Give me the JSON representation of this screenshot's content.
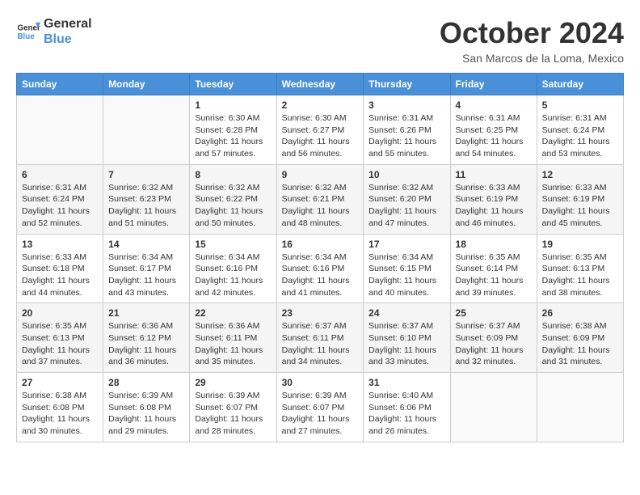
{
  "logo": {
    "line1": "General",
    "line2": "Blue"
  },
  "title": "October 2024",
  "location": "San Marcos de la Loma, Mexico",
  "days_header": [
    "Sunday",
    "Monday",
    "Tuesday",
    "Wednesday",
    "Thursday",
    "Friday",
    "Saturday"
  ],
  "weeks": [
    [
      {
        "day": "",
        "info": ""
      },
      {
        "day": "",
        "info": ""
      },
      {
        "day": "1",
        "info": "Sunrise: 6:30 AM\nSunset: 6:28 PM\nDaylight: 11 hours and 57 minutes."
      },
      {
        "day": "2",
        "info": "Sunrise: 6:30 AM\nSunset: 6:27 PM\nDaylight: 11 hours and 56 minutes."
      },
      {
        "day": "3",
        "info": "Sunrise: 6:31 AM\nSunset: 6:26 PM\nDaylight: 11 hours and 55 minutes."
      },
      {
        "day": "4",
        "info": "Sunrise: 6:31 AM\nSunset: 6:25 PM\nDaylight: 11 hours and 54 minutes."
      },
      {
        "day": "5",
        "info": "Sunrise: 6:31 AM\nSunset: 6:24 PM\nDaylight: 11 hours and 53 minutes."
      }
    ],
    [
      {
        "day": "6",
        "info": "Sunrise: 6:31 AM\nSunset: 6:24 PM\nDaylight: 11 hours and 52 minutes."
      },
      {
        "day": "7",
        "info": "Sunrise: 6:32 AM\nSunset: 6:23 PM\nDaylight: 11 hours and 51 minutes."
      },
      {
        "day": "8",
        "info": "Sunrise: 6:32 AM\nSunset: 6:22 PM\nDaylight: 11 hours and 50 minutes."
      },
      {
        "day": "9",
        "info": "Sunrise: 6:32 AM\nSunset: 6:21 PM\nDaylight: 11 hours and 48 minutes."
      },
      {
        "day": "10",
        "info": "Sunrise: 6:32 AM\nSunset: 6:20 PM\nDaylight: 11 hours and 47 minutes."
      },
      {
        "day": "11",
        "info": "Sunrise: 6:33 AM\nSunset: 6:19 PM\nDaylight: 11 hours and 46 minutes."
      },
      {
        "day": "12",
        "info": "Sunrise: 6:33 AM\nSunset: 6:19 PM\nDaylight: 11 hours and 45 minutes."
      }
    ],
    [
      {
        "day": "13",
        "info": "Sunrise: 6:33 AM\nSunset: 6:18 PM\nDaylight: 11 hours and 44 minutes."
      },
      {
        "day": "14",
        "info": "Sunrise: 6:34 AM\nSunset: 6:17 PM\nDaylight: 11 hours and 43 minutes."
      },
      {
        "day": "15",
        "info": "Sunrise: 6:34 AM\nSunset: 6:16 PM\nDaylight: 11 hours and 42 minutes."
      },
      {
        "day": "16",
        "info": "Sunrise: 6:34 AM\nSunset: 6:16 PM\nDaylight: 11 hours and 41 minutes."
      },
      {
        "day": "17",
        "info": "Sunrise: 6:34 AM\nSunset: 6:15 PM\nDaylight: 11 hours and 40 minutes."
      },
      {
        "day": "18",
        "info": "Sunrise: 6:35 AM\nSunset: 6:14 PM\nDaylight: 11 hours and 39 minutes."
      },
      {
        "day": "19",
        "info": "Sunrise: 6:35 AM\nSunset: 6:13 PM\nDaylight: 11 hours and 38 minutes."
      }
    ],
    [
      {
        "day": "20",
        "info": "Sunrise: 6:35 AM\nSunset: 6:13 PM\nDaylight: 11 hours and 37 minutes."
      },
      {
        "day": "21",
        "info": "Sunrise: 6:36 AM\nSunset: 6:12 PM\nDaylight: 11 hours and 36 minutes."
      },
      {
        "day": "22",
        "info": "Sunrise: 6:36 AM\nSunset: 6:11 PM\nDaylight: 11 hours and 35 minutes."
      },
      {
        "day": "23",
        "info": "Sunrise: 6:37 AM\nSunset: 6:11 PM\nDaylight: 11 hours and 34 minutes."
      },
      {
        "day": "24",
        "info": "Sunrise: 6:37 AM\nSunset: 6:10 PM\nDaylight: 11 hours and 33 minutes."
      },
      {
        "day": "25",
        "info": "Sunrise: 6:37 AM\nSunset: 6:09 PM\nDaylight: 11 hours and 32 minutes."
      },
      {
        "day": "26",
        "info": "Sunrise: 6:38 AM\nSunset: 6:09 PM\nDaylight: 11 hours and 31 minutes."
      }
    ],
    [
      {
        "day": "27",
        "info": "Sunrise: 6:38 AM\nSunset: 6:08 PM\nDaylight: 11 hours and 30 minutes."
      },
      {
        "day": "28",
        "info": "Sunrise: 6:39 AM\nSunset: 6:08 PM\nDaylight: 11 hours and 29 minutes."
      },
      {
        "day": "29",
        "info": "Sunrise: 6:39 AM\nSunset: 6:07 PM\nDaylight: 11 hours and 28 minutes."
      },
      {
        "day": "30",
        "info": "Sunrise: 6:39 AM\nSunset: 6:07 PM\nDaylight: 11 hours and 27 minutes."
      },
      {
        "day": "31",
        "info": "Sunrise: 6:40 AM\nSunset: 6:06 PM\nDaylight: 11 hours and 26 minutes."
      },
      {
        "day": "",
        "info": ""
      },
      {
        "day": "",
        "info": ""
      }
    ]
  ]
}
